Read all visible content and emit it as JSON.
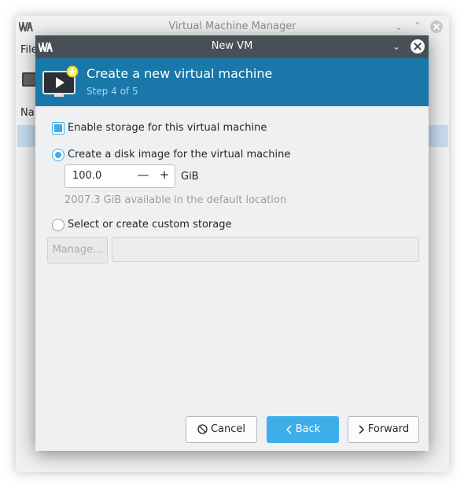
{
  "background_window": {
    "title": "Virtual Machine Manager",
    "menu_first": "File",
    "column_header": "Name"
  },
  "dialog": {
    "title": "New VM",
    "header_title": "Create a new virtual machine",
    "step": "Step 4 of 5",
    "enable_storage_label": "Enable storage for this virtual machine",
    "enable_storage_checked": true,
    "create_disk_label": "Create a disk image for the virtual machine",
    "disk_size_value": "100.0",
    "disk_size_unit": "GiB",
    "available_text": "2007.3 GiB available in the default location",
    "custom_storage_label": "Select or create custom storage",
    "manage_label": "Manage...",
    "storage_path": "",
    "buttons": {
      "cancel": "Cancel",
      "back": "Back",
      "forward": "Forward"
    }
  },
  "colors": {
    "accent": "#3daee9",
    "header": "#1a77a9",
    "titlebar": "#475057"
  }
}
